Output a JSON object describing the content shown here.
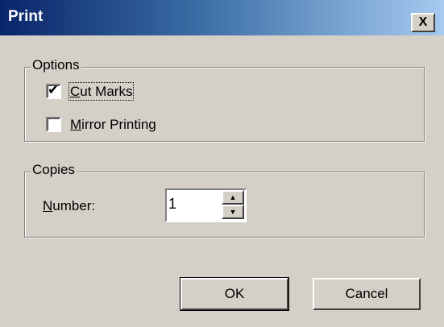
{
  "window": {
    "title": "Print",
    "close_label": "X"
  },
  "options": {
    "legend": "Options",
    "cut_marks": {
      "label": "Cut Marks",
      "checked": true
    },
    "mirror_printing": {
      "label": "Mirror Printing",
      "checked": false
    }
  },
  "copies": {
    "legend": "Copies",
    "number_label": "Number:",
    "number_value": "1"
  },
  "buttons": {
    "ok": "OK",
    "cancel": "Cancel"
  }
}
